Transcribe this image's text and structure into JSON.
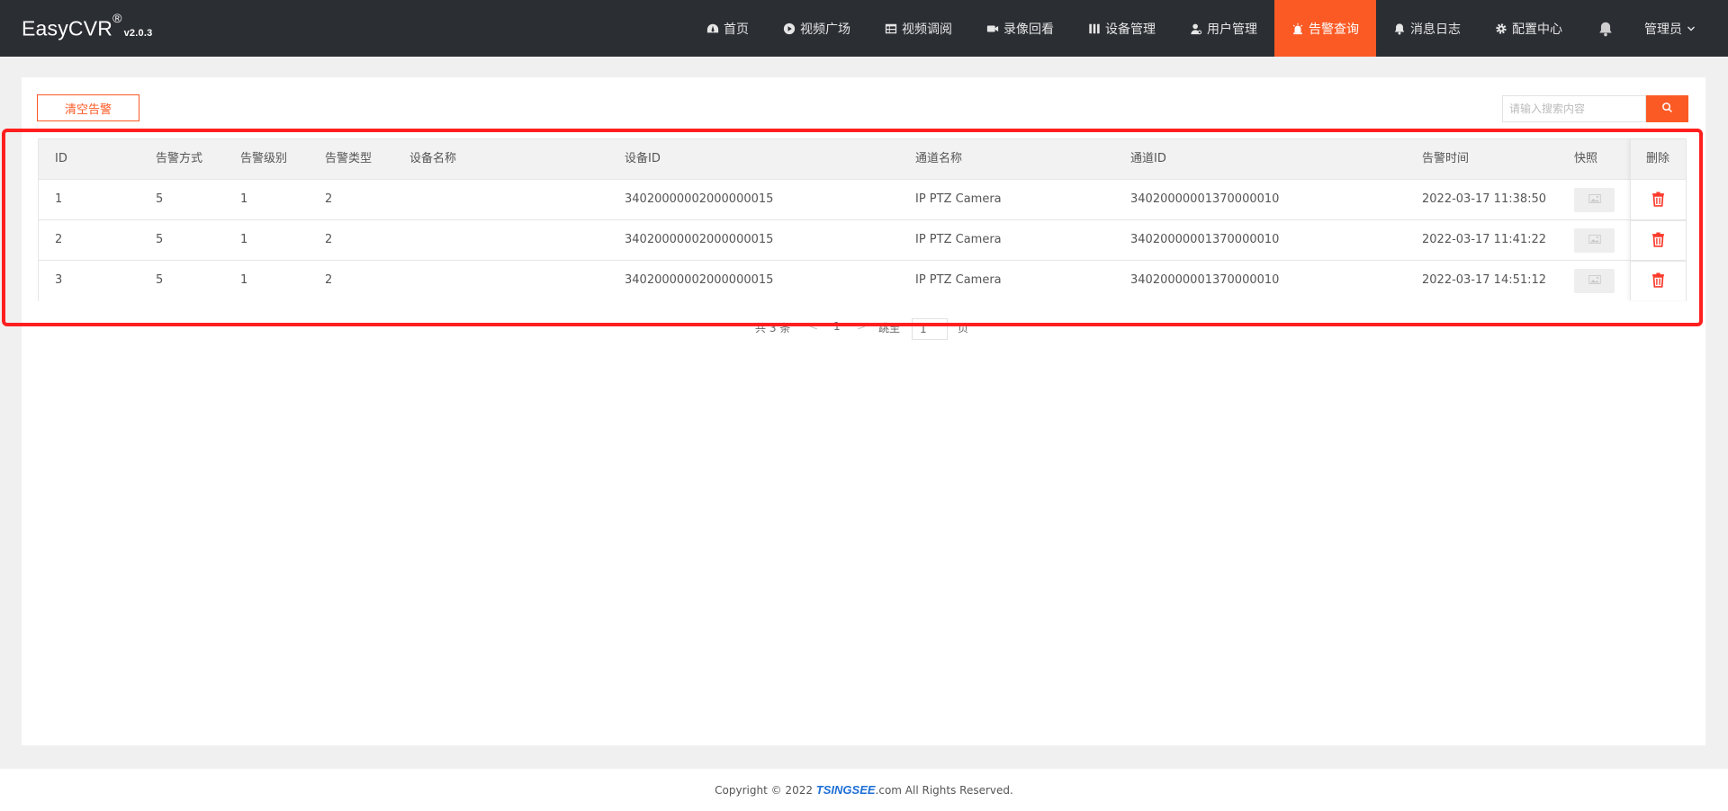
{
  "app": {
    "name": "EasyCVR",
    "registered": "®",
    "version": "v2.0.3"
  },
  "nav": [
    {
      "label": "首页",
      "icon": "dashboard-icon",
      "active": false
    },
    {
      "label": "视频广场",
      "icon": "play-circle-icon",
      "active": false
    },
    {
      "label": "视频调阅",
      "icon": "table-icon",
      "active": false
    },
    {
      "label": "录像回看",
      "icon": "video-camera-icon",
      "active": false
    },
    {
      "label": "设备管理",
      "icon": "columns-icon",
      "active": false
    },
    {
      "label": "用户管理",
      "icon": "user-gear-icon",
      "active": false
    },
    {
      "label": "告警查询",
      "icon": "alarm-light-icon",
      "active": true
    },
    {
      "label": "消息日志",
      "icon": "bell-icon",
      "active": false
    },
    {
      "label": "配置中心",
      "icon": "gear-icon",
      "active": false
    }
  ],
  "user": {
    "label": "管理员",
    "icon": "chevron-down-icon"
  },
  "toolbar": {
    "clear_label": "清空告警",
    "search_placeholder": "请输入搜索内容",
    "search_icon": "search-icon"
  },
  "table": {
    "columns": [
      "ID",
      "告警方式",
      "告警级别",
      "告警类型",
      "设备名称",
      "设备ID",
      "通道名称",
      "通道ID",
      "告警时间",
      "快照",
      "删除"
    ],
    "rows": [
      {
        "id": "1",
        "method": "5",
        "level": "1",
        "type": "2",
        "device_name": "",
        "device_id": "34020000002000000015",
        "channel_name": "IP PTZ Camera",
        "channel_id": "34020000001370000010",
        "time": "2022-03-17 11:38:50"
      },
      {
        "id": "2",
        "method": "5",
        "level": "1",
        "type": "2",
        "device_name": "",
        "device_id": "34020000002000000015",
        "channel_name": "IP PTZ Camera",
        "channel_id": "34020000001370000010",
        "time": "2022-03-17 11:41:22"
      },
      {
        "id": "3",
        "method": "5",
        "level": "1",
        "type": "2",
        "device_name": "",
        "device_id": "34020000002000000015",
        "channel_name": "IP PTZ Camera",
        "channel_id": "34020000001370000010",
        "time": "2022-03-17 14:51:12"
      }
    ]
  },
  "pagination": {
    "total_text": "共 3 条",
    "prev": "<",
    "current_page": "1",
    "next": ">",
    "jump_label": "跳至",
    "jump_value": "1",
    "page_suffix": "页"
  },
  "footer": {
    "prefix": "Copyright © 2022 ",
    "brand": "TSINGSEE",
    "suffix": ".com All Rights Reserved."
  },
  "colors": {
    "accent": "#fb5a25",
    "header_bg": "#2b2e33",
    "highlight": "#ff1f1f",
    "brand_blue": "#1d6fd6"
  }
}
